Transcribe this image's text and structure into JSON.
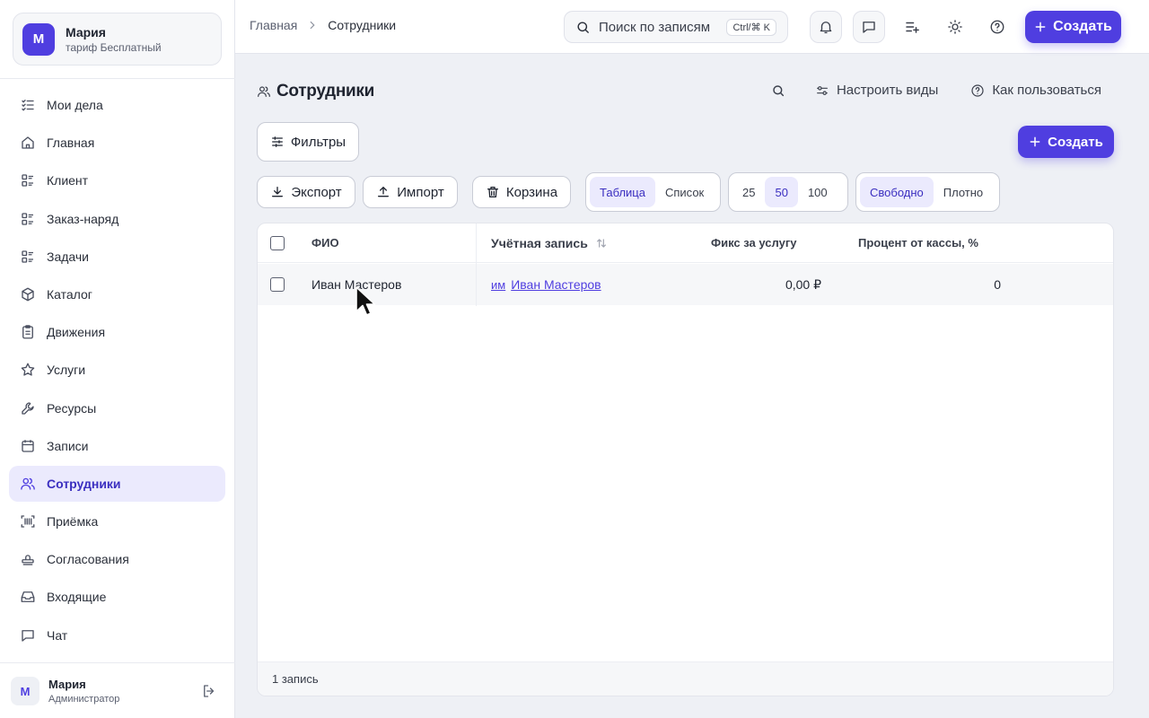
{
  "workspace": {
    "initial": "М",
    "name": "Мария",
    "plan": "тариф Бесплатный"
  },
  "sidebar": {
    "items": [
      {
        "label": "Мои дела",
        "icon": "task-list-icon"
      },
      {
        "label": "Главная",
        "icon": "home-icon"
      },
      {
        "label": "Клиент",
        "icon": "list-icon"
      },
      {
        "label": "Заказ-наряд",
        "icon": "list-icon"
      },
      {
        "label": "Задачи",
        "icon": "list-icon"
      },
      {
        "label": "Каталог",
        "icon": "box-icon"
      },
      {
        "label": "Движения",
        "icon": "clipboard-icon"
      },
      {
        "label": "Услуги",
        "icon": "star-icon"
      },
      {
        "label": "Ресурсы",
        "icon": "wrench-icon"
      },
      {
        "label": "Записи",
        "icon": "calendar-icon"
      },
      {
        "label": "Сотрудники",
        "icon": "users-icon",
        "active": true
      },
      {
        "label": "Приёмка",
        "icon": "barcode-scan-icon"
      },
      {
        "label": "Согласования",
        "icon": "stamp-icon"
      },
      {
        "label": "Входящие",
        "icon": "inbox-icon"
      },
      {
        "label": "Чат",
        "icon": "chat-icon"
      }
    ]
  },
  "user": {
    "initial": "М",
    "name": "Мария",
    "role": "Администратор"
  },
  "topbar": {
    "breadcrumb": {
      "home": "Главная",
      "current": "Сотрудники"
    },
    "search_placeholder": "Поиск по записям",
    "shortcut": "Ctrl/⌘ K",
    "create_label": "Создать"
  },
  "page": {
    "title": "Сотрудники",
    "configure_views": "Настроить виды",
    "how_to_use": "Как пользоваться",
    "filters": "Фильтры",
    "create": "Создать",
    "export": "Экспорт",
    "import": "Импорт",
    "trash": "Корзина",
    "view_modes": [
      "Таблица",
      "Список"
    ],
    "selected_view": "Таблица",
    "page_sizes": [
      "25",
      "50",
      "100"
    ],
    "selected_page_size": "50",
    "density": [
      "Свободно",
      "Плотно"
    ],
    "selected_density": "Свободно"
  },
  "table": {
    "columns": [
      "ФИО",
      "Учётная запись",
      "Фикс за услугу",
      "Процент от кассы, %"
    ],
    "rows": [
      {
        "name": "Иван Мастеров",
        "account_tag": "им",
        "account": "Иван Мастеров",
        "fix": "0,00 ₽",
        "percent": "0"
      }
    ],
    "footer": "1 запись"
  },
  "colors": {
    "accent": "#4f3ee0",
    "active_bg": "#ebeafd"
  }
}
